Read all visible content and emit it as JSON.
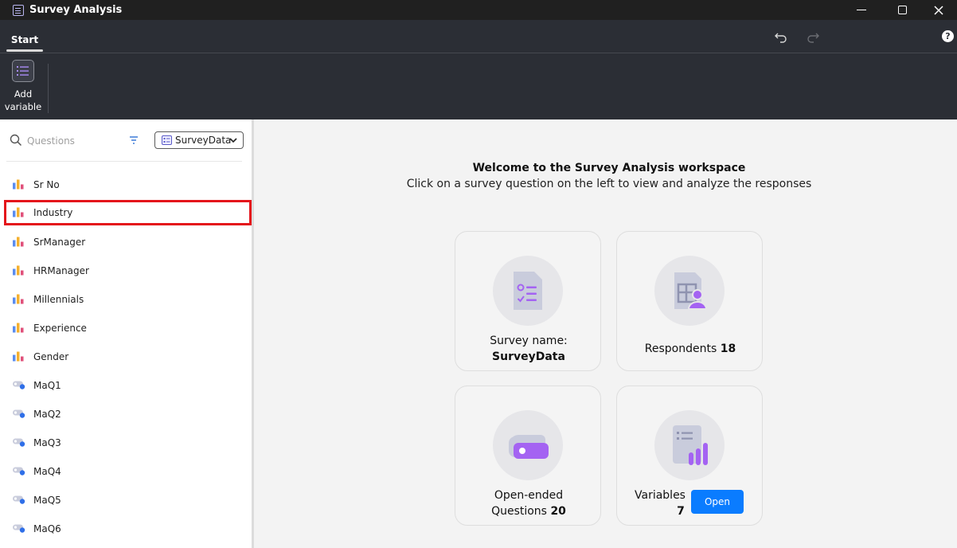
{
  "window": {
    "title": "Survey Analysis"
  },
  "ribbon": {
    "tabs": [
      {
        "label": "Start"
      }
    ],
    "add_variable_label": "Add variable"
  },
  "sidebar": {
    "search_placeholder": "Questions",
    "dataset_selected": "SurveyData",
    "questions": [
      {
        "label": "Sr No",
        "icon": "bar-chart-icon"
      },
      {
        "label": "Industry",
        "icon": "bar-chart-icon",
        "selected": true
      },
      {
        "label": "SrManager",
        "icon": "bar-chart-icon"
      },
      {
        "label": "HRManager",
        "icon": "bar-chart-icon"
      },
      {
        "label": "Millennials",
        "icon": "bar-chart-icon"
      },
      {
        "label": "Experience",
        "icon": "bar-chart-icon"
      },
      {
        "label": "Gender",
        "icon": "bar-chart-icon"
      },
      {
        "label": "MaQ1",
        "icon": "toggle-icon"
      },
      {
        "label": "MaQ2",
        "icon": "toggle-icon"
      },
      {
        "label": "MaQ3",
        "icon": "toggle-icon"
      },
      {
        "label": "MaQ4",
        "icon": "toggle-icon"
      },
      {
        "label": "MaQ5",
        "icon": "toggle-icon"
      },
      {
        "label": "MaQ6",
        "icon": "toggle-icon"
      }
    ]
  },
  "main": {
    "welcome_title": "Welcome to the Survey Analysis workspace",
    "welcome_subtitle": "Click on a survey question on the left to view and analyze the responses",
    "cards": {
      "survey_name_label": "Survey name:",
      "survey_name_value": "SurveyData",
      "respondents_label": "Respondents",
      "respondents_value": "18",
      "open_ended_label_1": "Open-ended",
      "open_ended_label_2": "Questions",
      "open_ended_value": "20",
      "variables_label": "Variables",
      "variables_value": "7",
      "open_button": "Open"
    }
  },
  "colors": {
    "accent": "#0a7cff",
    "selection_border": "#e4141b",
    "icon_purple": "#a463f2",
    "icon_slate": "#c9ccdc"
  }
}
